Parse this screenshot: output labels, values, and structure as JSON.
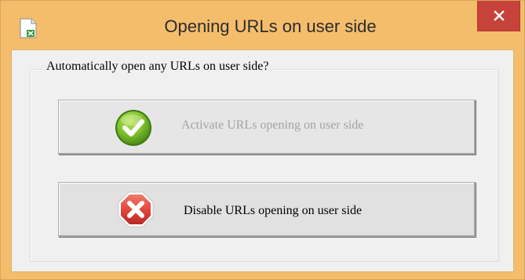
{
  "window": {
    "title": "Opening URLs on user side",
    "close_symbol": "✕",
    "title_bar_color": "#f4bd6c",
    "close_button_color": "#c7423a"
  },
  "group": {
    "label": "Automatically open any URLs on user side?"
  },
  "buttons": [
    {
      "label": "Activate URLs opening on user side",
      "icon": "check-circle-icon",
      "enabled": false,
      "icon_color": "#7cbf2a"
    },
    {
      "label": "Disable URLs opening on user side",
      "icon": "cross-octagon-icon",
      "enabled": true,
      "icon_color": "#e0443a"
    }
  ]
}
